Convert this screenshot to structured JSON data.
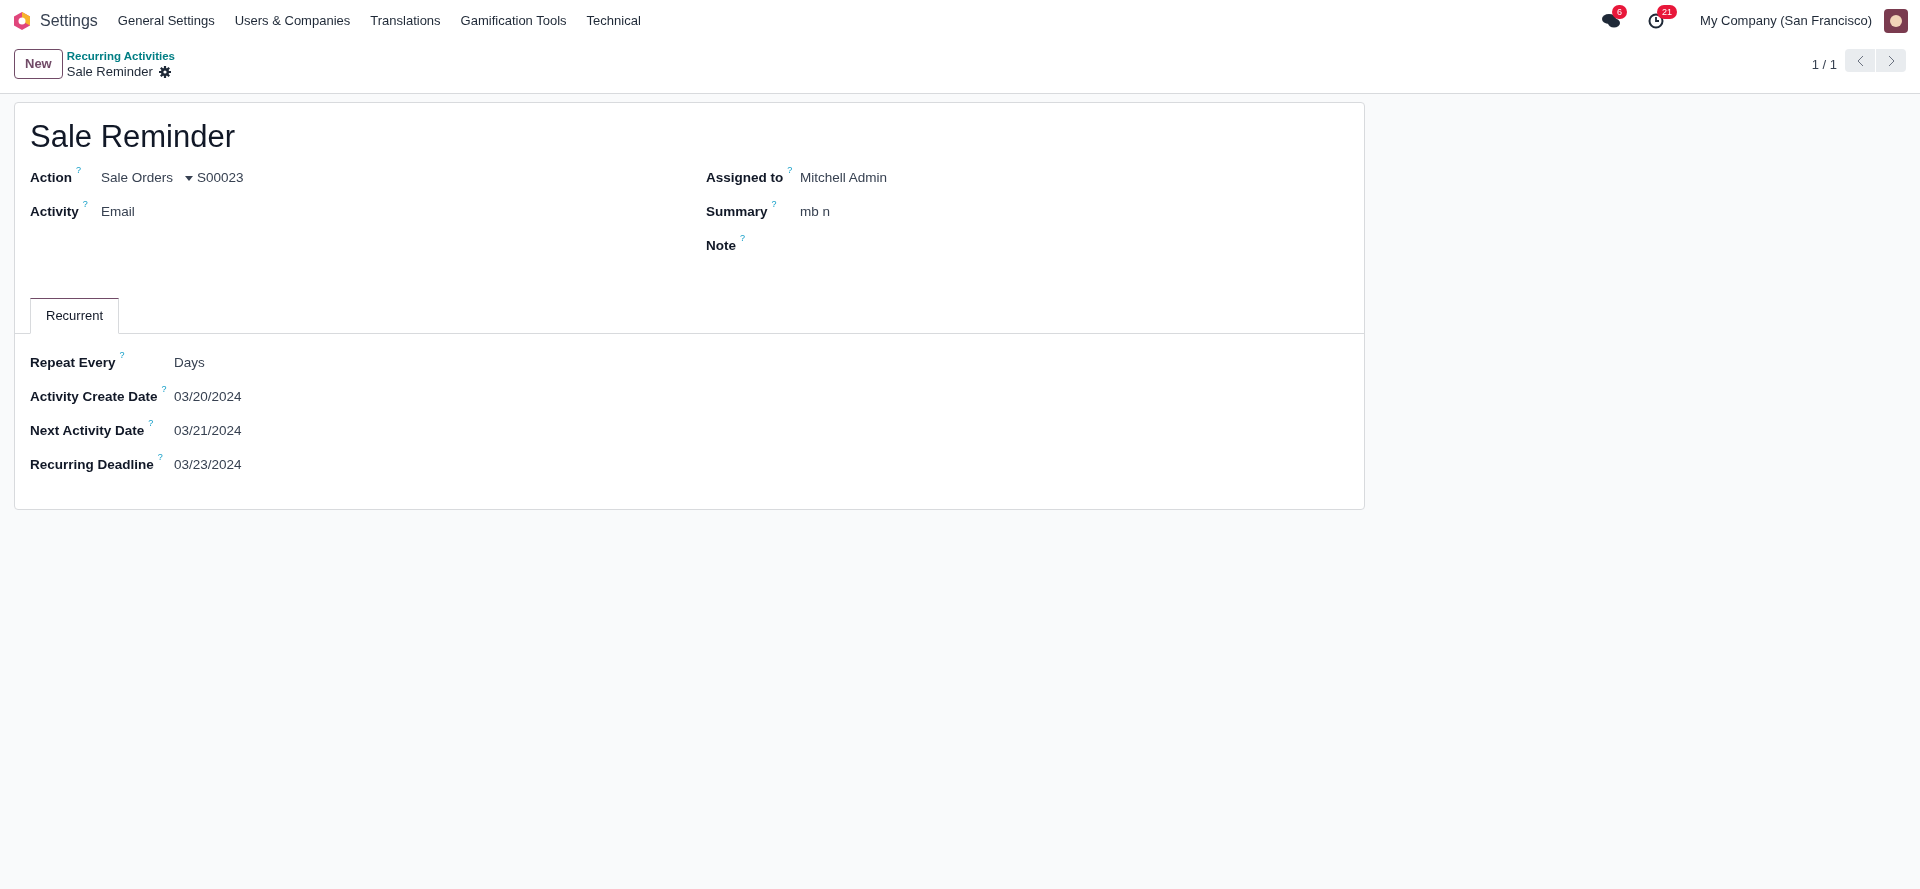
{
  "navbar": {
    "app": "Settings",
    "menu": [
      "General Settings",
      "Users & Companies",
      "Translations",
      "Gamification Tools",
      "Technical"
    ],
    "messages_badge": "6",
    "activities_badge": "21",
    "company": "My Company (San Francisco)"
  },
  "control_panel": {
    "new_button": "New",
    "breadcrumb_parent": "Recurring Activities",
    "breadcrumb_current": "Sale Reminder",
    "pager": "1 / 1"
  },
  "form": {
    "title": "Sale Reminder",
    "help_mark": "?",
    "left_fields": [
      {
        "label": "Action",
        "value": "Sale Orders",
        "linked": "S00023"
      },
      {
        "label": "Activity",
        "value": "Email"
      }
    ],
    "right_fields": [
      {
        "label": "Assigned to",
        "value": "Mitchell Admin"
      },
      {
        "label": "Summary",
        "value": "mb n"
      },
      {
        "label": "Note"
      }
    ],
    "tabs": [
      {
        "label": "Recurrent",
        "selected": true
      }
    ],
    "tab_fields": [
      {
        "label": "Repeat Every",
        "value": "Days"
      },
      {
        "label": "Activity Create Date",
        "value": "03/20/2024"
      },
      {
        "label": "Next Activity Date",
        "value": "03/21/2024"
      },
      {
        "label": "Recurring Deadline",
        "value": "03/23/2024"
      }
    ]
  }
}
